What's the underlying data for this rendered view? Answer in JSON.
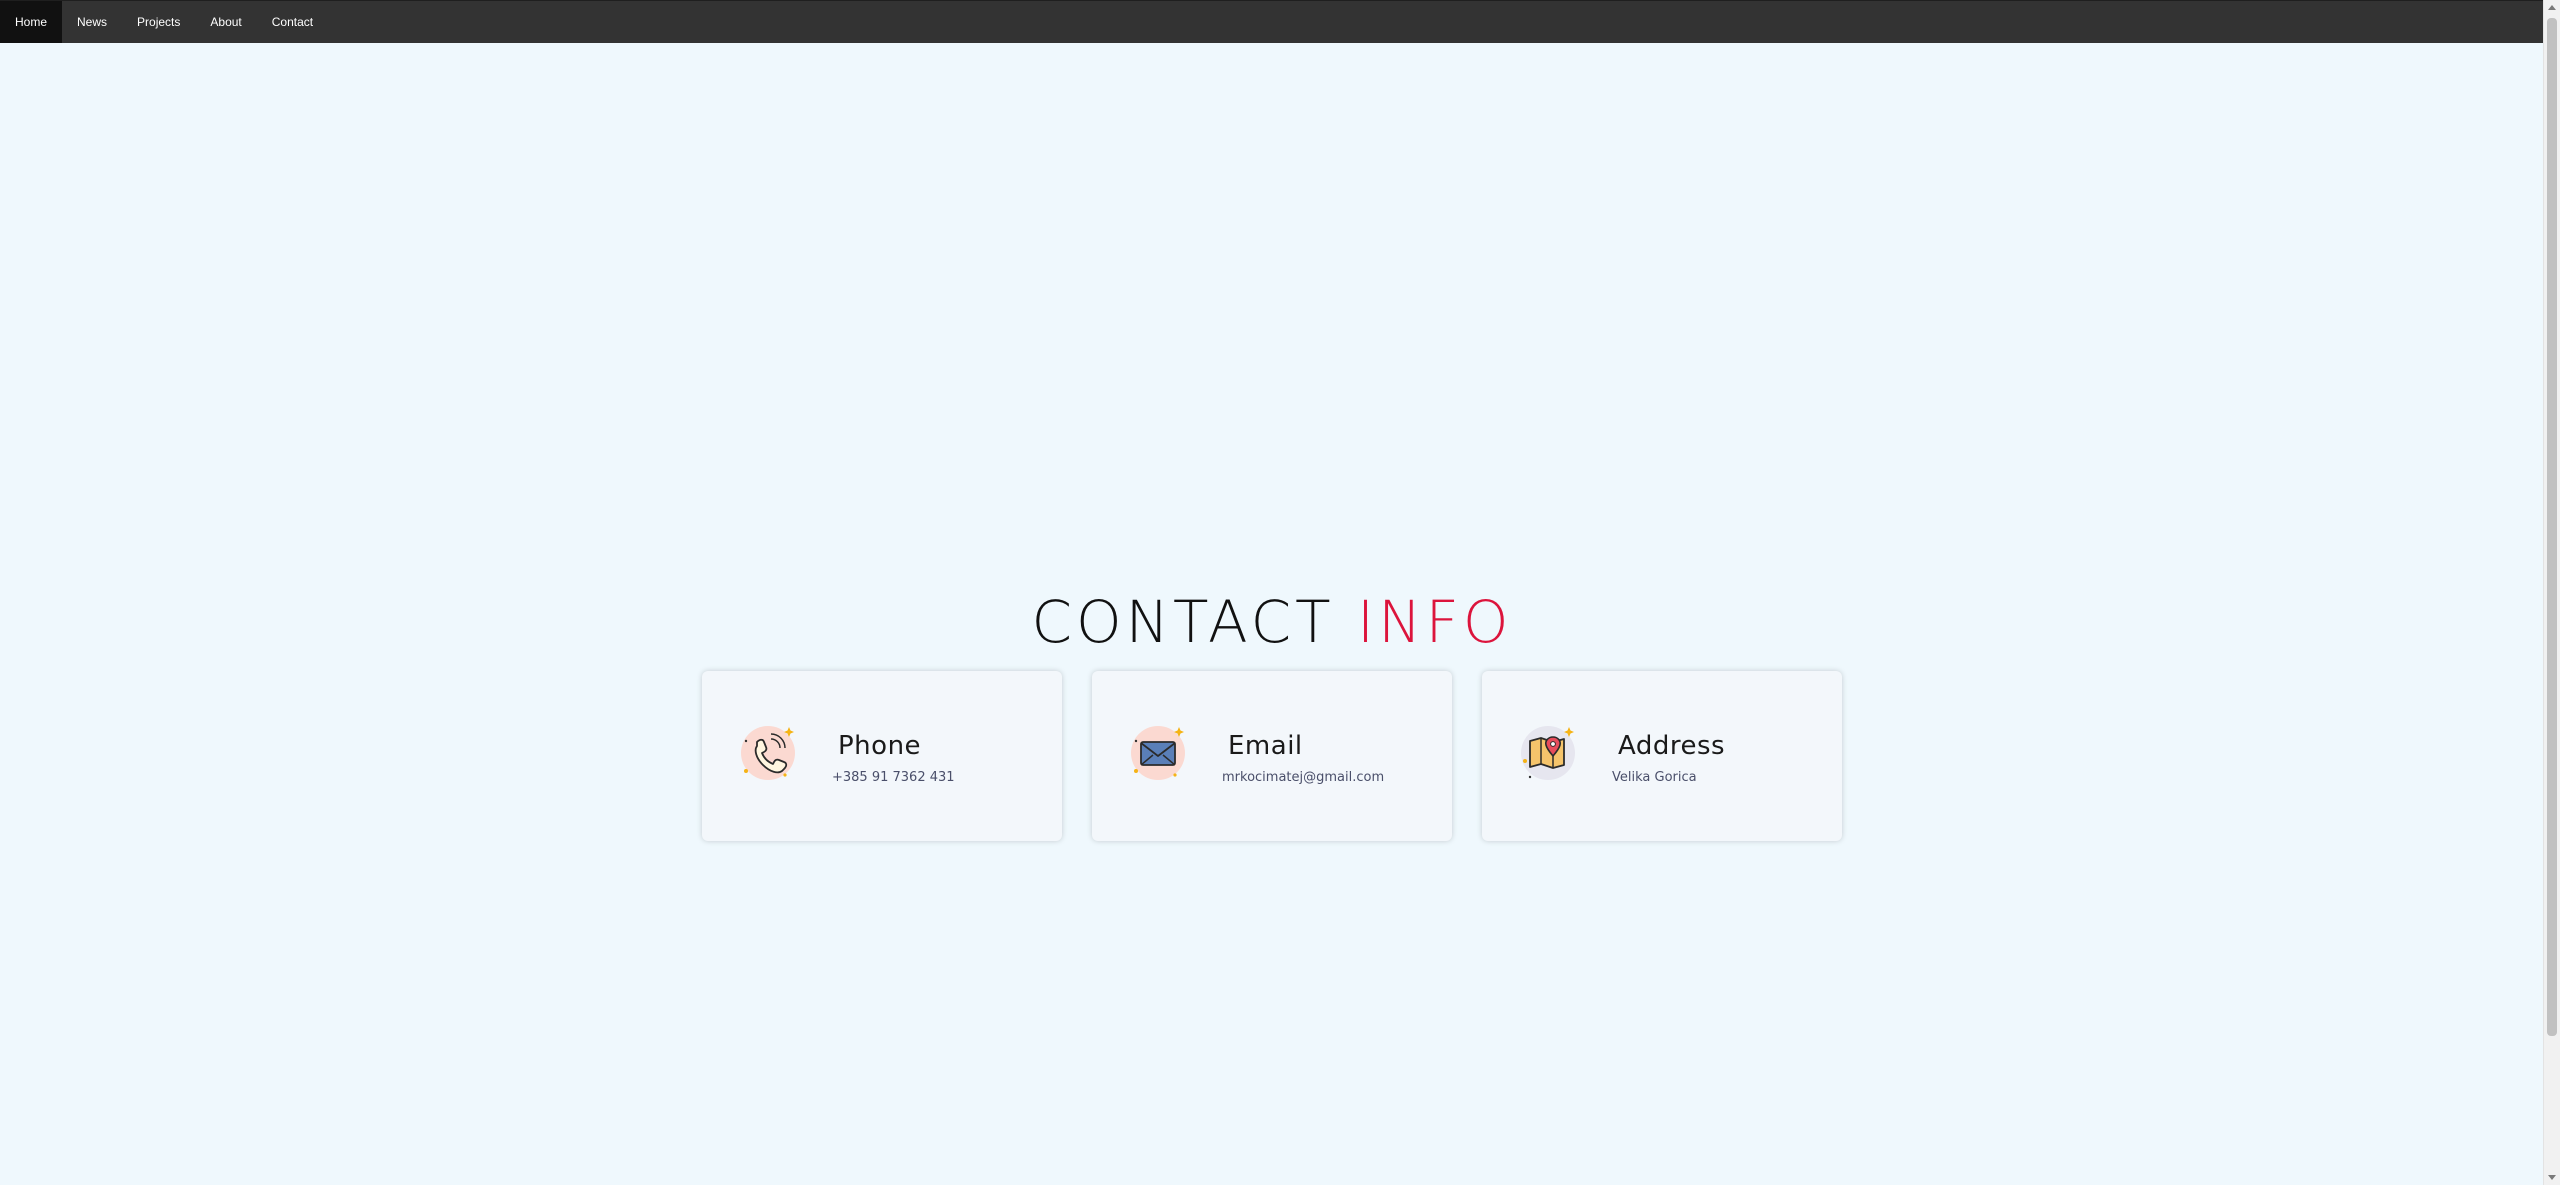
{
  "nav": {
    "items": [
      {
        "label": "Home",
        "active": true
      },
      {
        "label": "News",
        "active": false
      },
      {
        "label": "Projects",
        "active": false
      },
      {
        "label": "About",
        "active": false
      },
      {
        "label": "Contact",
        "active": false
      }
    ]
  },
  "section": {
    "heading_main": "CONTACT ",
    "heading_accent": "INFO",
    "accent_color": "#dc143c"
  },
  "cards": [
    {
      "title": "Phone",
      "value": "+385 91 7362 431",
      "icon": "phone-icon"
    },
    {
      "title": "Email",
      "value": "mrkocimatej@gmail.com",
      "icon": "envelope-icon"
    },
    {
      "title": "Address",
      "value": "Velika Gorica",
      "icon": "map-pin-icon"
    }
  ],
  "colors": {
    "nav_bg": "#333333",
    "nav_active_bg": "#111111",
    "page_bg": "#eff8fd",
    "card_bg": "#f3f7fb"
  }
}
